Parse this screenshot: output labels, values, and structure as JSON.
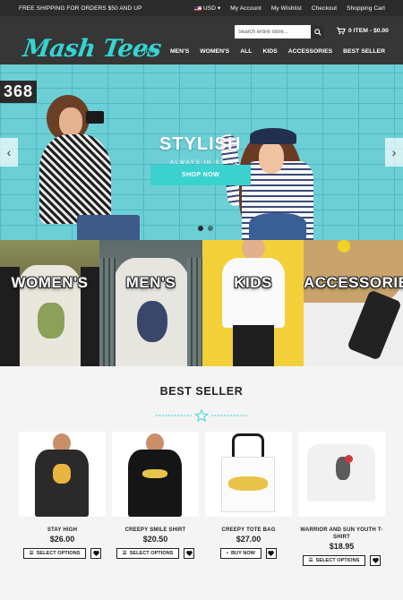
{
  "topbar": {
    "promo": "FREE SHIPPING FOR ORDERS $50 AND UP",
    "currency": "USD",
    "links": [
      "My Account",
      "My Wishlist",
      "Checkout",
      "Shopping Cart"
    ]
  },
  "header": {
    "logo": "Mash Tees",
    "search_placeholder": "Search entire store...",
    "cart_label": "0 ITEM - $0.00",
    "nav": [
      "HOME",
      "MEN'S",
      "WOMEN'S",
      "ALL",
      "KIDS",
      "ACCESSORIES",
      "BEST SELLER"
    ],
    "active_nav": "HOME"
  },
  "hero": {
    "number": "368",
    "title": "STYLISH",
    "subtitle": "ALWAYS IN STYLE",
    "button": "SHOP NOW"
  },
  "categories": [
    "WOMEN'S",
    "MEN'S",
    "KIDS",
    "ACCESSORIES"
  ],
  "best_seller": {
    "title": "BEST SELLER",
    "products": [
      {
        "name": "STAY HIGH",
        "price": "$26.00",
        "action": "SELECT OPTIONS"
      },
      {
        "name": "CREEPY SMILE SHIRT",
        "price": "$20.50",
        "action": "SELECT OPTIONS"
      },
      {
        "name": "CREEPY TOTE BAG",
        "price": "$27.00",
        "action": "BUY NOW"
      },
      {
        "name": "WARRIOR AND SUN YOUTH T-SHIRT",
        "price": "$18.95",
        "action": "SELECT OPTIONS"
      }
    ]
  },
  "colors": {
    "accent": "#35d4d1",
    "dark": "#363636",
    "topbar": "#2b2b2b"
  }
}
